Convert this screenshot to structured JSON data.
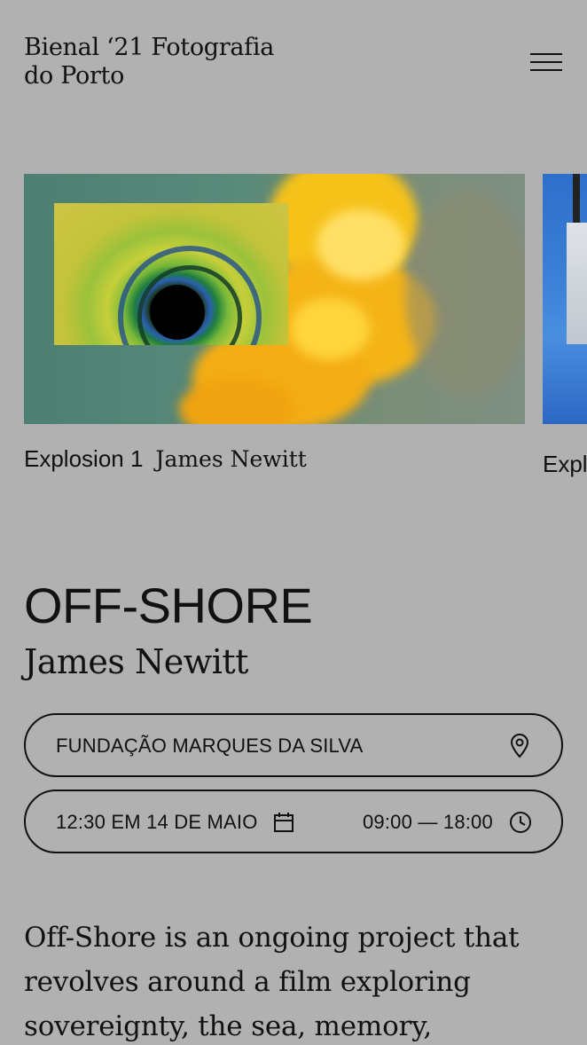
{
  "header": {
    "brand_line1": "Bienal ‘21 Fotografia",
    "brand_line2": "do Porto",
    "menu_icon": "hamburger-menu-icon"
  },
  "carousel": {
    "slides": [
      {
        "title": "Explosion 1",
        "artist": "James Newitt"
      },
      {
        "title": "Expl"
      }
    ]
  },
  "exhibition": {
    "title": "OFF-SHORE",
    "artist": "James Newitt",
    "venue": "FUNDAÇÃO MARQUES DA SILVA",
    "venue_icon": "map-pin-icon",
    "date": "12:30 EM 14 DE MAIO",
    "date_icon": "calendar-icon",
    "hours": "09:00 — 18:00",
    "hours_icon": "clock-icon",
    "description": "Off-Shore is an ongoing project that revolves around a film  exploring sovereignty, the sea, memory,"
  },
  "colors": {
    "background": "#b1b1b1",
    "text": "#111111"
  }
}
